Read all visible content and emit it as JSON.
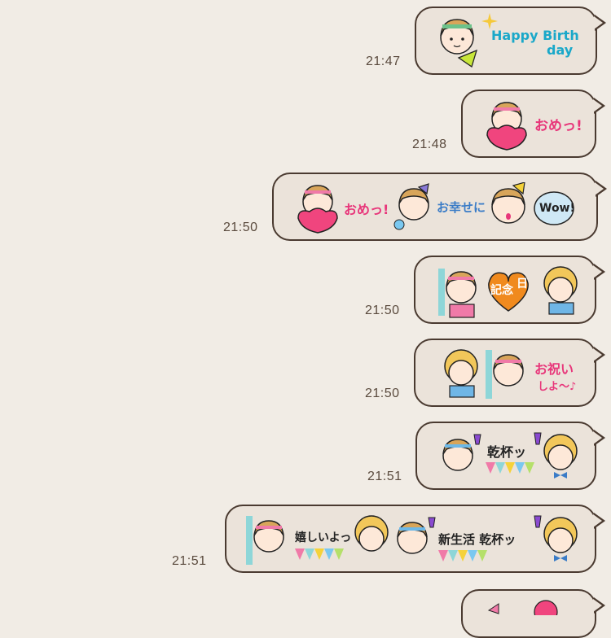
{
  "messages": [
    {
      "time": "21:47",
      "captions": [
        "Happy Birth",
        "day"
      ]
    },
    {
      "time": "21:48",
      "captions": [
        "おめっ!"
      ]
    },
    {
      "time": "21:50",
      "captions": [
        "おめっ!",
        "お幸せに",
        "Wow!"
      ]
    },
    {
      "time": "21:50",
      "captions": [
        "記念",
        "日"
      ]
    },
    {
      "time": "21:50",
      "captions": [
        "お祝い",
        "しよ〜♪"
      ]
    },
    {
      "time": "21:51",
      "captions": [
        "乾杯ッ"
      ]
    },
    {
      "time": "21:51",
      "captions": [
        "嬉しいよっ",
        "新生活 乾杯ッ"
      ]
    }
  ],
  "colors": {
    "background": "#f1ece5",
    "bubble": "#ebe3da",
    "border": "#4a3a30",
    "accent_pink": "#e8367a"
  },
  "icons": [
    "girl-sticker-icon",
    "heart-icon",
    "glass-icon",
    "bunting-icon",
    "sparkle-icon"
  ]
}
